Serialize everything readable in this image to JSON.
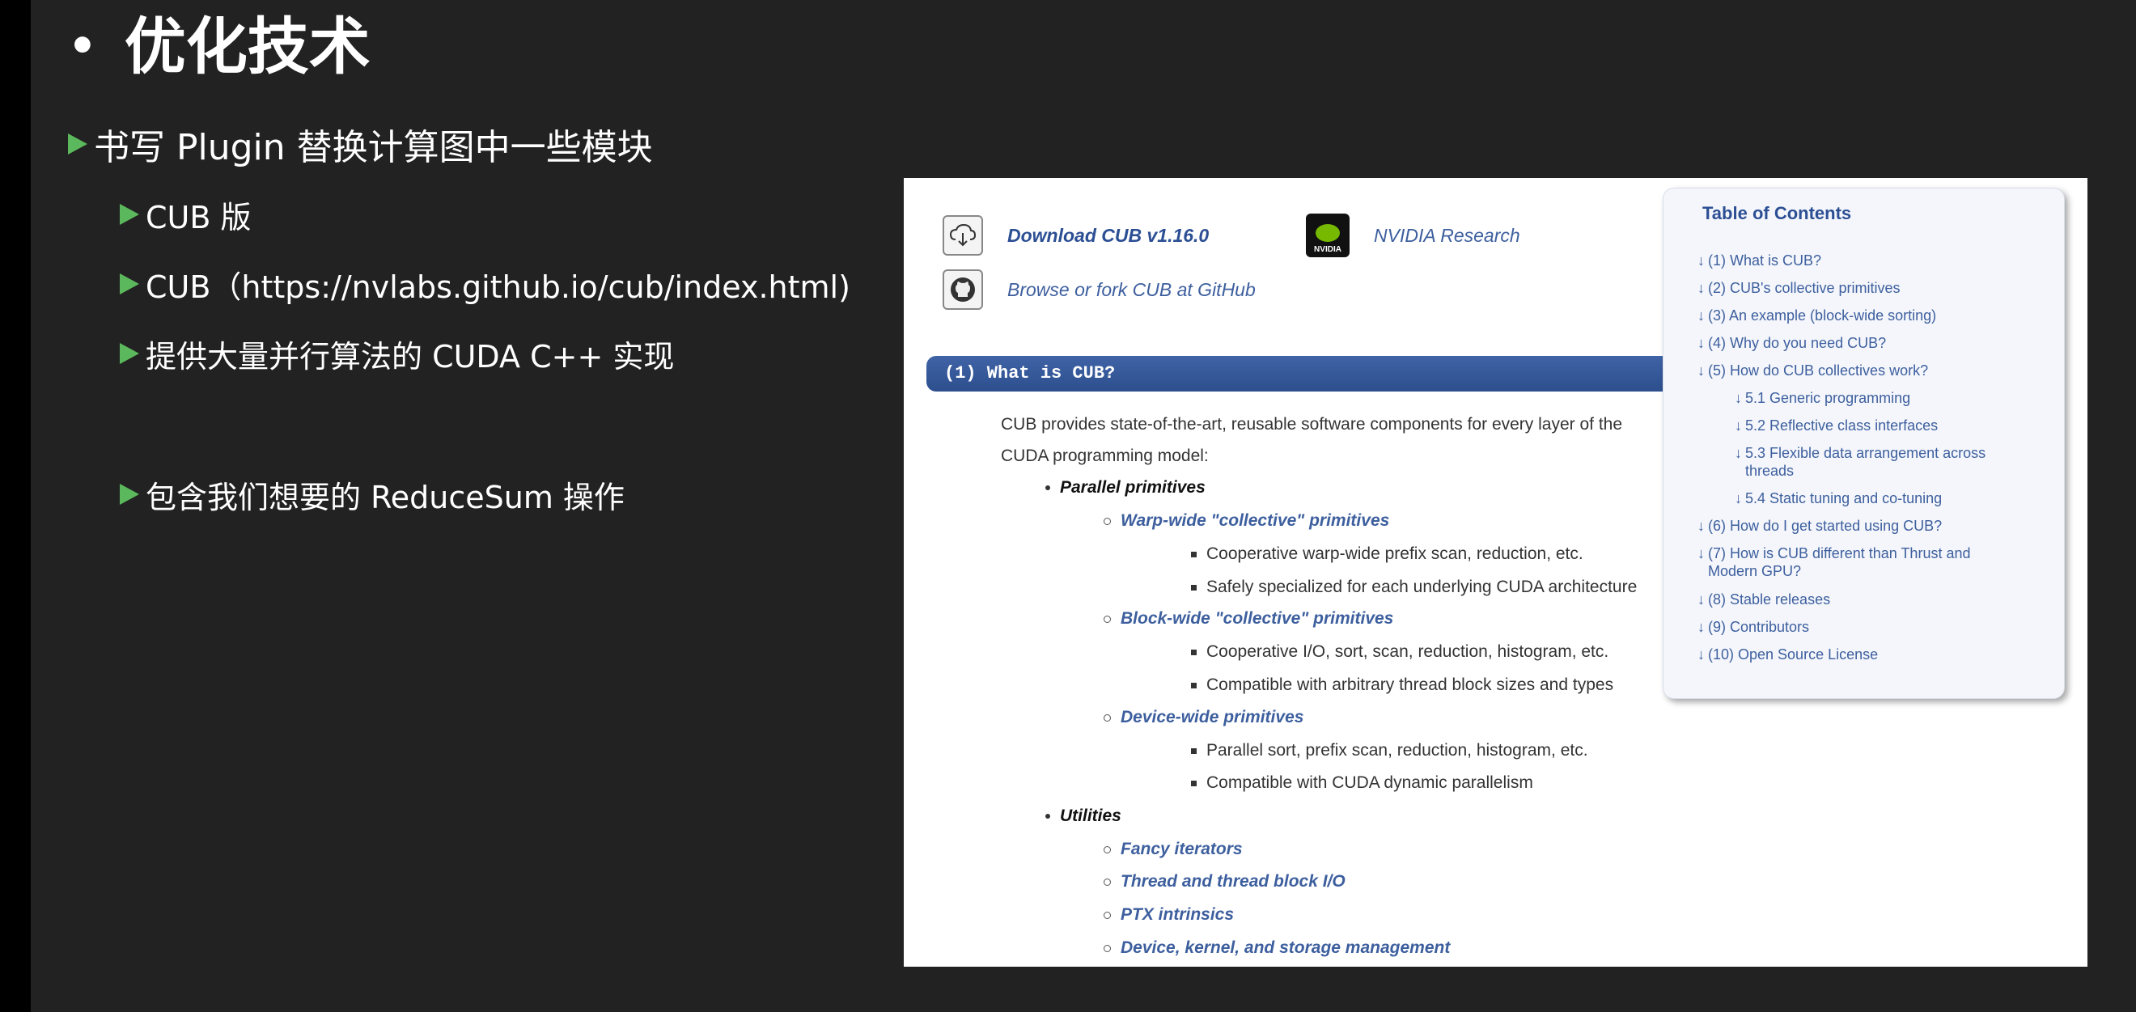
{
  "slide": {
    "title": "优化技术",
    "bullet1": "书写 Plugin 替换计算图中一些模块",
    "sub_bullets": [
      "CUB 版",
      "CUB（https://nvlabs.github.io/cub/index.html)",
      "提供大量并行算法的 CUDA C++ 实现",
      "包含我们想要的 ReduceSum 操作"
    ]
  },
  "web": {
    "download_link": "Download CUB v1.16.0",
    "nvidia_link": "NVIDIA Research",
    "nvidia_icon_text": "NVIDIA",
    "github_link": "Browse or fork CUB at GitHub",
    "section_header": "(1) What is CUB?",
    "intro": "CUB provides state-of-the-art, reusable software components for every layer of the CUDA programming model:",
    "list": {
      "parallel": "Parallel primitives",
      "warp": "Warp-wide \"collective\" primitives",
      "warp_1": "Cooperative warp-wide prefix scan, reduction, etc.",
      "warp_2": "Safely specialized for each underlying CUDA architecture",
      "block": "Block-wide \"collective\" primitives",
      "block_1": "Cooperative I/O, sort, scan, reduction, histogram, etc.",
      "block_2": "Compatible with arbitrary thread block sizes and types",
      "device": "Device-wide primitives",
      "device_1": "Parallel sort, prefix scan, reduction, histogram, etc.",
      "device_2": "Compatible with CUDA dynamic parallelism",
      "utilities": "Utilities",
      "util_1": "Fancy iterators",
      "util_2": "Thread and thread block I/O",
      "util_3": "PTX intrinsics",
      "util_4": "Device, kernel, and storage management"
    },
    "toc": {
      "title": "Table of Contents",
      "items": [
        "(1) What is CUB?",
        "(2) CUB's collective primitives",
        "(3) An example (block-wide sorting)",
        "(4) Why do you need CUB?",
        "(5) How do CUB collectives work?",
        "5.1 Generic programming",
        "5.2 Reflective class interfaces",
        "5.3 Flexible data arrangement across threads",
        "5.4 Static tuning and co-tuning",
        "(6) How do I get started using CUB?",
        "(7) How is CUB different than Thrust and Modern GPU?",
        "(8) Stable releases",
        "(9) Contributors",
        "(10) Open Source License"
      ]
    }
  },
  "colors": {
    "slide_bg": "#222222",
    "bullet_arrow": "#5cb85c",
    "link": "#3d5f9e",
    "header": "#2d4f8e"
  }
}
